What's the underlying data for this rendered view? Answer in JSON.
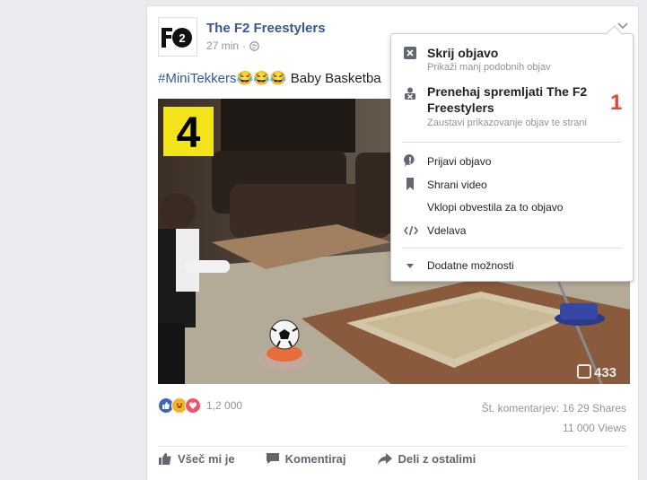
{
  "post": {
    "page_name": "The F2 Freestylers",
    "time": "27 min",
    "time_sep": "·",
    "hashtag": "#MiniTekkers",
    "emojis": "😂😂😂",
    "text": " Baby Basketba",
    "video": {
      "badge_number": "4",
      "watermark": "433"
    },
    "reactions_count": "1,2 000",
    "comments": "Št. komentarjev: 16",
    "shares": "29 Shares",
    "views": "11 000 Views",
    "actions": {
      "like": "Všeč mi je",
      "comment": "Komentiraj",
      "share": "Deli z ostalimi"
    }
  },
  "menu": {
    "hide_title": "Skrij objavo",
    "hide_sub": "Prikaži manj podobnih objav",
    "unfollow_title": "Prenehaj spremljati The F2 Freestylers",
    "unfollow_sub": "Zaustavi prikazovanje objav te strani",
    "report": "Prijavi objavo",
    "save": "Shrani video",
    "notify": "Vklopi obvestila za to objavo",
    "embed": "Vdelava",
    "more": "Dodatne možnosti"
  },
  "annotation_marker": "1",
  "colors": {
    "link": "#365899",
    "muted": "#90949c",
    "marker": "#e9422e",
    "badge": "#f2e31a"
  }
}
